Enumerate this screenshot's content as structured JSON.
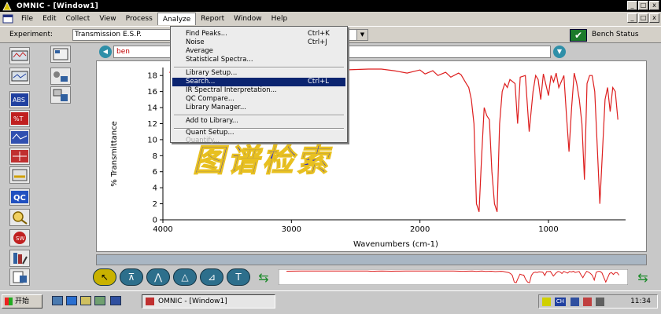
{
  "window": {
    "title": "OMNIC - [Window1]",
    "controls": [
      "_",
      "□",
      "x"
    ]
  },
  "menubar": {
    "items": [
      "File",
      "Edit",
      "Collect",
      "View",
      "Process",
      "Analyze",
      "Report",
      "Window",
      "Help"
    ],
    "active": "Analyze"
  },
  "experiment": {
    "label": "Experiment:",
    "value": "Transmission E.S.P.",
    "bench_status_label": "Bench Status"
  },
  "sample": {
    "name": "ben"
  },
  "analyze_menu": {
    "items": [
      {
        "label": "Find Peaks...",
        "shortcut": "Ctrl+K"
      },
      {
        "label": "Noise",
        "shortcut": "Ctrl+J"
      },
      {
        "label": "Average",
        "shortcut": ""
      },
      {
        "label": "Statistical Spectra...",
        "shortcut": ""
      },
      {
        "label": "Library Setup...",
        "shortcut": ""
      },
      {
        "label": "Search...",
        "shortcut": "Ctrl+L",
        "highlighted": true
      },
      {
        "label": "IR Spectral Interpretation...",
        "shortcut": ""
      },
      {
        "label": "QC Compare...",
        "shortcut": ""
      },
      {
        "label": "Library Manager...",
        "shortcut": ""
      },
      {
        "label": "Add to Library...",
        "shortcut": ""
      },
      {
        "label": "Quant Setup...",
        "shortcut": ""
      },
      {
        "label": "Quantify...",
        "shortcut": "",
        "disabled": true
      }
    ]
  },
  "overlay_text": "图谱检索",
  "chart_data": {
    "type": "line",
    "xlabel": "Wavenumbers (cm-1)",
    "ylabel": "% Transmittance",
    "x_ticks": [
      "4000",
      "3000",
      "2000",
      "1000"
    ],
    "y_ticks": [
      "0",
      "2",
      "4",
      "6",
      "8",
      "10",
      "12",
      "14",
      "16",
      "18"
    ],
    "xlim": [
      4000,
      400
    ],
    "ylim": [
      0,
      19
    ],
    "series": [
      {
        "color": "#dd1f1f",
        "x": [
          3950,
          3800,
          3600,
          3400,
          3200,
          3100,
          3050,
          3000,
          2950,
          2900,
          2850,
          2800,
          2700,
          2600,
          2400,
          2300,
          2200,
          2100,
          2000,
          1960,
          1900,
          1860,
          1800,
          1760,
          1700,
          1680,
          1640,
          1620,
          1600,
          1580,
          1560,
          1540,
          1520,
          1500,
          1480,
          1460,
          1440,
          1420,
          1400,
          1380,
          1360,
          1340,
          1320,
          1300,
          1260,
          1240,
          1220,
          1180,
          1150,
          1120,
          1100,
          1080,
          1060,
          1040,
          1000,
          980,
          960,
          940,
          920,
          880,
          860,
          840,
          820,
          800,
          780,
          760,
          740,
          720,
          700,
          680,
          660,
          640,
          600,
          560,
          540,
          520,
          500,
          480,
          460
        ],
        "y": [
          18.4,
          18.6,
          18.7,
          18.8,
          18.8,
          18.6,
          18.3,
          18.5,
          18.6,
          18.5,
          18.4,
          18.5,
          18.6,
          18.7,
          18.8,
          18.8,
          18.6,
          18.3,
          18.7,
          18.2,
          18.6,
          18.0,
          18.4,
          17.8,
          18.3,
          18.1,
          17.0,
          16.5,
          15.0,
          12.0,
          2.0,
          1.0,
          8.0,
          14.0,
          13.0,
          12.5,
          6.0,
          2.0,
          1.0,
          12.0,
          16.0,
          17.0,
          16.5,
          17.5,
          17.0,
          12.0,
          17.8,
          18.0,
          11.0,
          16.0,
          18.0,
          17.5,
          15.0,
          18.2,
          15.5,
          18.0,
          17.2,
          18.3,
          16.5,
          18.0,
          13.0,
          8.5,
          14.0,
          18.3,
          17.0,
          15.0,
          12.0,
          5.0,
          17.0,
          18.0,
          18.0,
          16.0,
          2.0,
          15.0,
          16.5,
          13.5,
          16.5,
          16.0,
          12.5
        ]
      }
    ]
  },
  "taskbar": {
    "start_label": "开始",
    "task_label": "OMNIC - [Window1]",
    "tray_lang": "CH",
    "clock": "11:34"
  }
}
